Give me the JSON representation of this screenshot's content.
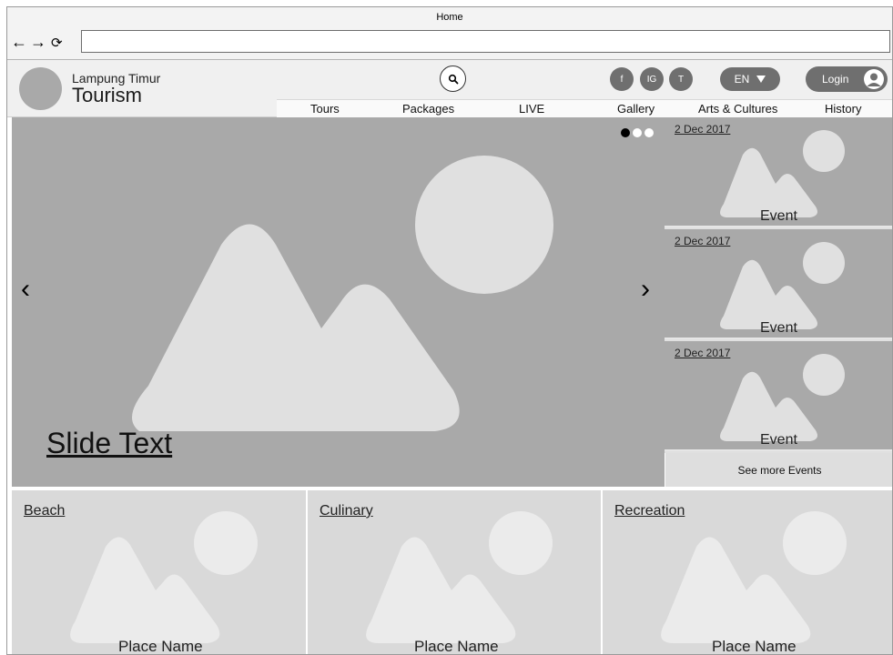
{
  "browser": {
    "tab_title": "Home",
    "back_glyph": "←",
    "forward_glyph": "→",
    "reload_glyph": "⟳",
    "url_value": ""
  },
  "header": {
    "brand_subtitle": "Lampung Timur",
    "brand_title": "Tourism",
    "social": {
      "facebook": "f",
      "instagram": "IG",
      "twitter": "T"
    },
    "language": "EN",
    "login_label": "Login",
    "menu": [
      "Tours",
      "Packages",
      "LIVE",
      "Gallery",
      "Arts & Cultures",
      "History"
    ]
  },
  "slider": {
    "caption": "Slide Text",
    "prev_glyph": "‹",
    "next_glyph": "›",
    "dot_count": 3,
    "active_dot": 1
  },
  "events": {
    "items": [
      {
        "date": "2 Dec 2017",
        "label": "Event"
      },
      {
        "date": "2 Dec 2017",
        "label": "Event"
      },
      {
        "date": "2 Dec 2017",
        "label": "Event"
      }
    ],
    "see_more": "See more Events"
  },
  "categories": [
    {
      "title": "Beach",
      "place": "Place Name"
    },
    {
      "title": "Culinary",
      "place": "Place Name"
    },
    {
      "title": "Recreation",
      "place": "Place Name"
    }
  ],
  "colors": {
    "placeholder_dark": "#a9a9a9",
    "placeholder_light": "#d9d9d9",
    "shape_fill": "#e0e0e0",
    "button_gray": "#6f6f6f"
  },
  "icons": {
    "search": "search-icon",
    "language_caret": "caret-down-icon",
    "avatar": "user-avatar-icon",
    "image_placeholder": "image-placeholder-icon"
  }
}
